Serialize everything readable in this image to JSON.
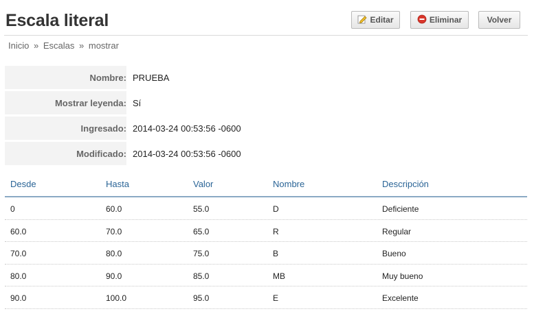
{
  "header": {
    "title": "Escala literal"
  },
  "actions": {
    "editar": "Editar",
    "eliminar": "Eliminar",
    "volver": "Volver"
  },
  "breadcrumb": {
    "inicio": "Inicio",
    "escalas": "Escalas",
    "current": "mostrar",
    "separator": "»"
  },
  "details": [
    {
      "label": "Nombre:",
      "value": "PRUEBA"
    },
    {
      "label": "Mostrar leyenda:",
      "value": "Sí"
    },
    {
      "label": "Ingresado:",
      "value": "2014-03-24 00:53:56 -0600"
    },
    {
      "label": "Modificado:",
      "value": "2014-03-24 00:53:56 -0600"
    }
  ],
  "table": {
    "headers": [
      "Desde",
      "Hasta",
      "Valor",
      "Nombre",
      "Descripción"
    ],
    "rows": [
      [
        "0",
        "60.0",
        "55.0",
        "D",
        "Deficiente"
      ],
      [
        "60.0",
        "70.0",
        "65.0",
        "R",
        "Regular"
      ],
      [
        "70.0",
        "80.0",
        "75.0",
        "B",
        "Bueno"
      ],
      [
        "80.0",
        "90.0",
        "85.0",
        "MB",
        "Muy bueno"
      ],
      [
        "90.0",
        "100.0",
        "95.0",
        "E",
        "Excelente"
      ]
    ]
  },
  "icons": {
    "editar": "pencil-icon",
    "eliminar": "delete-icon"
  },
  "colors": {
    "header_text": "#2a6496",
    "delete_icon": "#d9362b",
    "header_rule": "#8aa9c4"
  }
}
